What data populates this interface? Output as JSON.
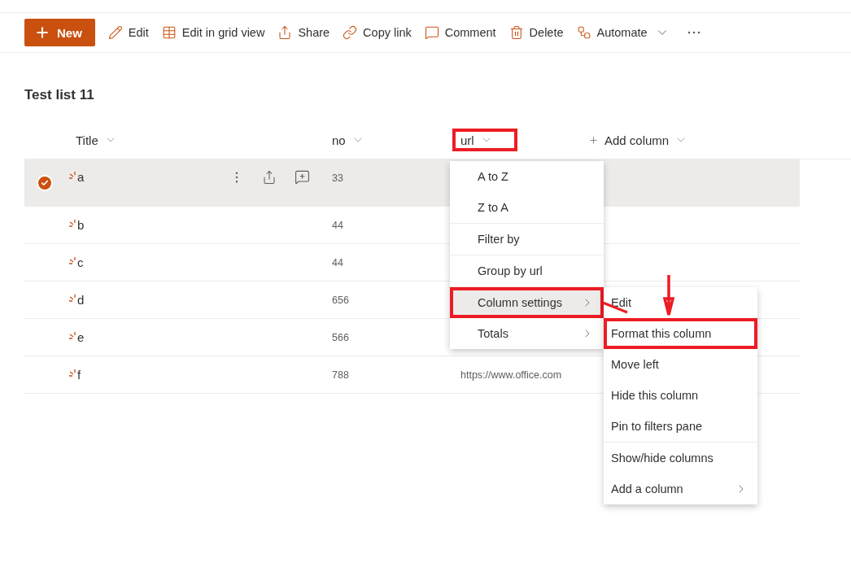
{
  "toolbar": [
    {
      "kind": "primary",
      "label": "New"
    },
    {
      "kind": "edit",
      "label": "Edit"
    },
    {
      "kind": "grid",
      "label": "Edit in grid view"
    },
    {
      "kind": "share",
      "label": "Share"
    },
    {
      "kind": "link",
      "label": "Copy link"
    },
    {
      "kind": "comment",
      "label": "Comment"
    },
    {
      "kind": "delete",
      "label": "Delete"
    },
    {
      "kind": "automate",
      "label": "Automate"
    },
    {
      "kind": "more"
    }
  ],
  "list_title": "Test list 11",
  "columns": [
    {
      "kind": "title",
      "label": "Title",
      "annotated": false
    },
    {
      "kind": "plain",
      "label": "no",
      "annotated": false
    },
    {
      "kind": "plain",
      "label": "url",
      "annotated": true
    },
    {
      "kind": "add",
      "label": "Add column",
      "annotated": false
    }
  ],
  "rows": [
    {
      "title": "a",
      "no": "33",
      "url": "",
      "selected": true,
      "is_new": true
    },
    {
      "title": "b",
      "no": "44",
      "url": "",
      "selected": false,
      "is_new": true
    },
    {
      "title": "c",
      "no": "44",
      "url": "",
      "selected": false,
      "is_new": true
    },
    {
      "title": "d",
      "no": "656",
      "url": "",
      "selected": false,
      "is_new": true
    },
    {
      "title": "e",
      "no": "566",
      "url": "",
      "selected": false,
      "is_new": true
    },
    {
      "title": "f",
      "no": "788",
      "url": "https://www.office.com",
      "selected": false,
      "is_new": true
    }
  ],
  "column_menu": {
    "sections": [
      [
        {
          "label": "A to Z",
          "submenu": false,
          "selected": false,
          "annotated": false
        },
        {
          "label": "Z to A",
          "submenu": false,
          "selected": false,
          "annotated": false
        }
      ],
      [
        {
          "label": "Filter by",
          "submenu": false,
          "selected": false,
          "annotated": false
        }
      ],
      [
        {
          "label": "Group by url",
          "submenu": false,
          "selected": false,
          "annotated": false
        }
      ],
      [
        {
          "label": "Column settings",
          "submenu": true,
          "selected": true,
          "annotated": true
        },
        {
          "label": "Totals",
          "submenu": true,
          "selected": false,
          "annotated": false
        }
      ]
    ]
  },
  "settings_submenu": {
    "sections": [
      [
        {
          "label": "Edit",
          "submenu": false,
          "annotated": false
        },
        {
          "label": "Format this column",
          "submenu": false,
          "annotated": true
        },
        {
          "label": "Move left",
          "submenu": false,
          "annotated": false
        },
        {
          "label": "Hide this column",
          "submenu": false,
          "annotated": false
        },
        {
          "label": "Pin to filters pane",
          "submenu": false,
          "annotated": false
        }
      ],
      [
        {
          "label": "Show/hide columns",
          "submenu": false,
          "annotated": false
        },
        {
          "label": "Add a column",
          "submenu": true,
          "annotated": false
        }
      ]
    ]
  }
}
